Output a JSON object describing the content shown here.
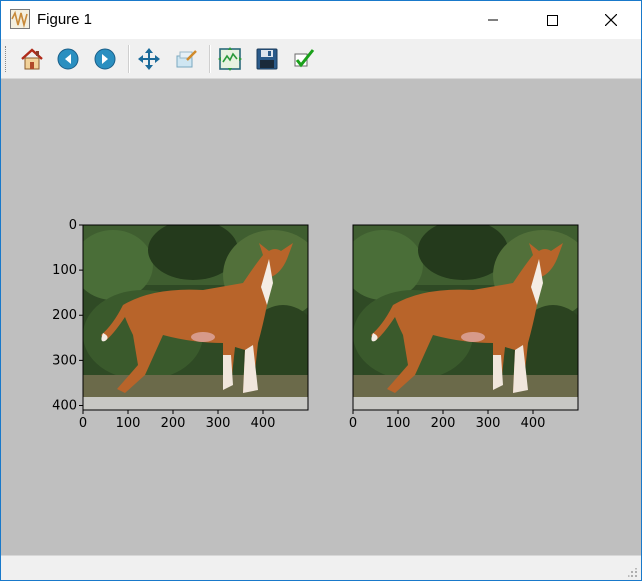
{
  "window": {
    "title": "Figure 1",
    "controls": {
      "minimize_icon": "minimize-icon",
      "maximize_icon": "maximize-icon",
      "close_icon": "close-icon"
    }
  },
  "toolbar": {
    "buttons": [
      {
        "name": "home",
        "icon": "home-icon"
      },
      {
        "name": "back",
        "icon": "back-arrow-icon"
      },
      {
        "name": "forward",
        "icon": "forward-arrow-icon"
      },
      {
        "name": "pan",
        "icon": "pan-icon"
      },
      {
        "name": "zoom",
        "icon": "zoom-icon"
      },
      {
        "name": "configure-subplots",
        "icon": "subplots-icon"
      },
      {
        "name": "save",
        "icon": "floppy-disk-icon"
      },
      {
        "name": "edit-parameters",
        "icon": "checkmark-icon"
      }
    ]
  },
  "figure": {
    "background": "#bfbfbf",
    "subplots": [
      {
        "image": "dog-photo",
        "x_ticks": [
          "0",
          "100",
          "200",
          "300",
          "400"
        ],
        "y_ticks": [
          "0",
          "100",
          "200",
          "300",
          "400"
        ]
      },
      {
        "image": "dog-photo",
        "x_ticks": [
          "0",
          "100",
          "200",
          "300",
          "400"
        ],
        "y_ticks": []
      }
    ],
    "x_ticks": [
      0,
      100,
      200,
      300,
      400
    ],
    "y_ticks": [
      0,
      100,
      200,
      300,
      400
    ],
    "x_range": [
      0,
      500
    ],
    "y_range": [
      0,
      410
    ]
  }
}
